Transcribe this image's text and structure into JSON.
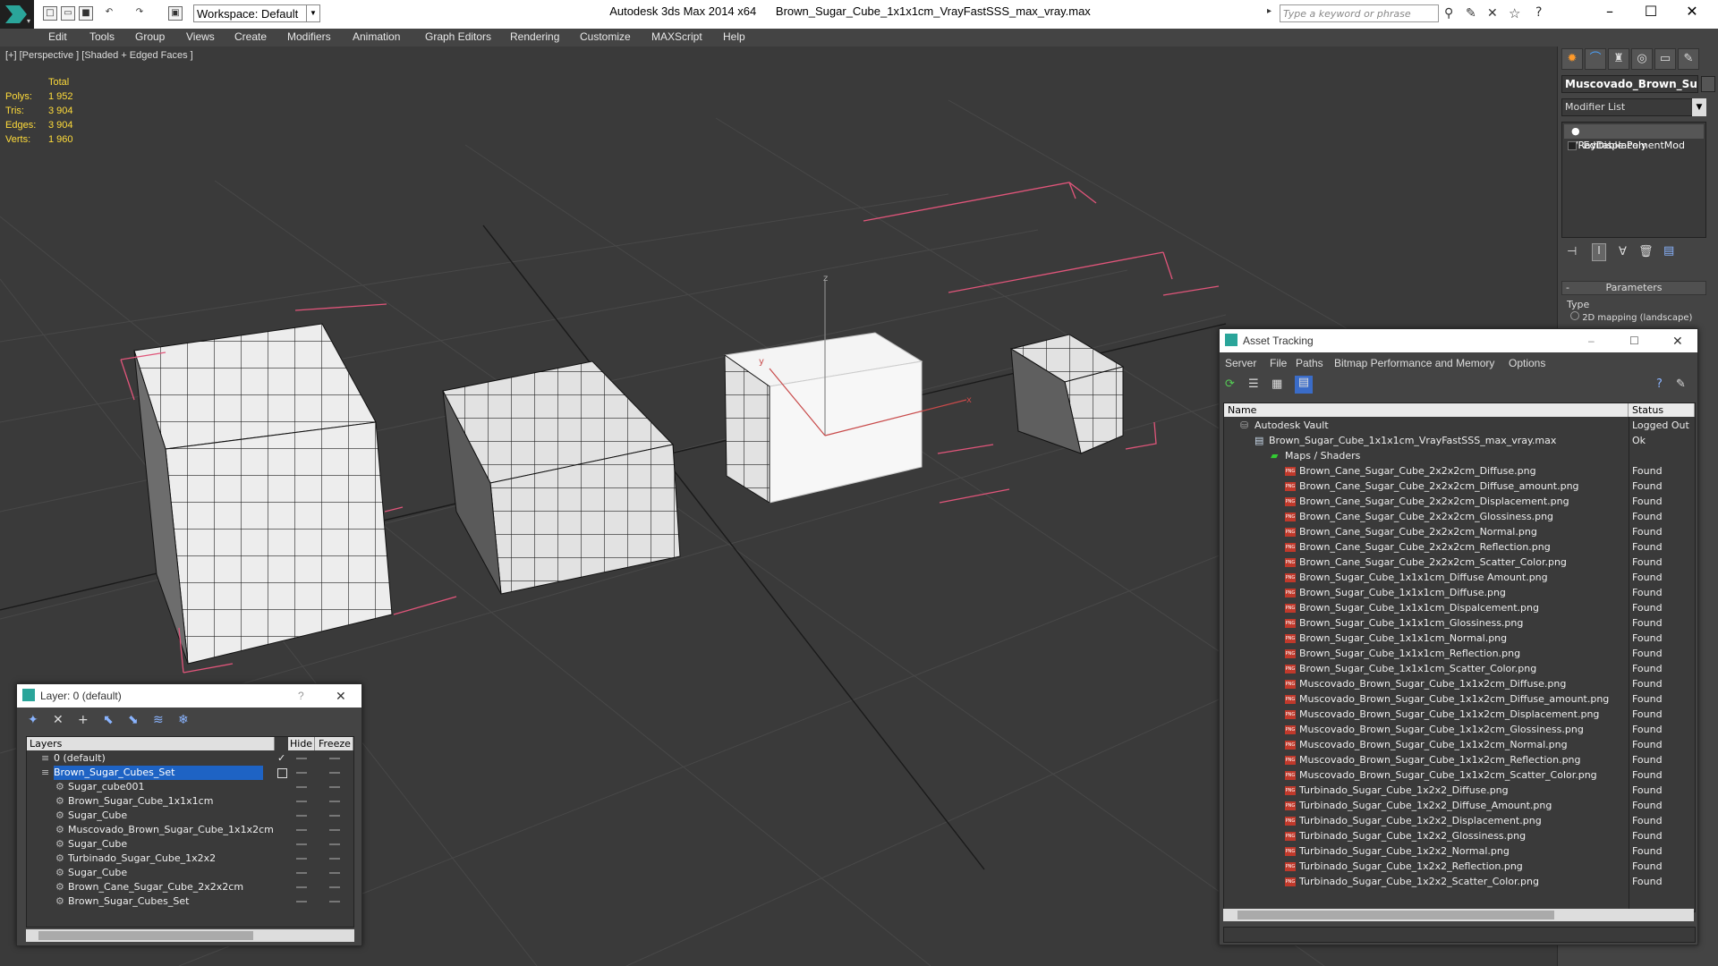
{
  "titlebar": {
    "workspace": "Workspace: Default",
    "app_name": "Autodesk 3ds Max  2014 x64",
    "file_name": "Brown_Sugar_Cube_1x1x1cm_VrayFastSSS_max_vray.max",
    "search_placeholder": "Type a keyword or phrase"
  },
  "menu": [
    "Edit",
    "Tools",
    "Group",
    "Views",
    "Create",
    "Modifiers",
    "Animation",
    "Graph Editors",
    "Rendering",
    "Customize",
    "MAXScript",
    "Help"
  ],
  "viewport": {
    "label": "[+] [Perspective ] [Shaded + Edged Faces ]",
    "stats": {
      "header": "Total",
      "rows": [
        {
          "k": "Polys:",
          "v": "1 952"
        },
        {
          "k": "Tris:",
          "v": "3 904"
        },
        {
          "k": "Edges:",
          "v": "3 904"
        },
        {
          "k": "Verts:",
          "v": "1 960"
        }
      ]
    },
    "axis_labels": {
      "x": "x",
      "y": "y",
      "z": "z"
    }
  },
  "command_panel": {
    "object_name": "Muscovado_Brown_Suga",
    "modifier_list": "Modifier List",
    "stack": [
      "VRayDisplacementMod",
      "Editable Poly"
    ],
    "params_header": "Parameters",
    "type_label": "Type",
    "type_option": "2D mapping (landscape)"
  },
  "layer_window": {
    "title": "Layer: 0 (default)",
    "help": "?",
    "columns": [
      "Layers",
      "Hide",
      "Freeze"
    ],
    "rows": [
      {
        "name": "0 (default)",
        "level": 0,
        "selected": false,
        "check": true
      },
      {
        "name": "Brown_Sugar_Cubes_Set",
        "level": 0,
        "selected": true,
        "check": false
      },
      {
        "name": "Sugar_cube001",
        "level": 1,
        "selected": false,
        "check": false
      },
      {
        "name": "Brown_Sugar_Cube_1x1x1cm",
        "level": 1,
        "selected": false,
        "check": false
      },
      {
        "name": "Sugar_Cube",
        "level": 1,
        "selected": false,
        "check": false
      },
      {
        "name": "Muscovado_Brown_Sugar_Cube_1x1x2cm",
        "level": 1,
        "selected": false,
        "check": false
      },
      {
        "name": "Sugar_Cube",
        "level": 1,
        "selected": false,
        "check": false
      },
      {
        "name": "Turbinado_Sugar_Cube_1x2x2",
        "level": 1,
        "selected": false,
        "check": false
      },
      {
        "name": "Sugar_Cube",
        "level": 1,
        "selected": false,
        "check": false
      },
      {
        "name": "Brown_Cane_Sugar_Cube_2x2x2cm",
        "level": 1,
        "selected": false,
        "check": false
      },
      {
        "name": "Brown_Sugar_Cubes_Set",
        "level": 1,
        "selected": false,
        "check": false
      }
    ]
  },
  "asset_window": {
    "title": "Asset Tracking",
    "menu": [
      "Server",
      "File",
      "Paths",
      "Bitmap Performance and Memory",
      "Options"
    ],
    "columns": [
      "Name",
      "Status"
    ],
    "rows": [
      {
        "name": "Autodesk Vault",
        "status": "Logged Out",
        "level": 0,
        "icon": "vault"
      },
      {
        "name": "Brown_Sugar_Cube_1x1x1cm_VrayFastSSS_max_vray.max",
        "status": "Ok",
        "level": 1,
        "icon": "file"
      },
      {
        "name": "Maps / Shaders",
        "status": "",
        "level": 2,
        "icon": "maps"
      },
      {
        "name": "Brown_Cane_Sugar_Cube_2x2x2cm_Diffuse.png",
        "status": "Found",
        "level": 3,
        "icon": "png"
      },
      {
        "name": "Brown_Cane_Sugar_Cube_2x2x2cm_Diffuse_amount.png",
        "status": "Found",
        "level": 3,
        "icon": "png"
      },
      {
        "name": "Brown_Cane_Sugar_Cube_2x2x2cm_Displacement.png",
        "status": "Found",
        "level": 3,
        "icon": "png"
      },
      {
        "name": "Brown_Cane_Sugar_Cube_2x2x2cm_Glossiness.png",
        "status": "Found",
        "level": 3,
        "icon": "png"
      },
      {
        "name": "Brown_Cane_Sugar_Cube_2x2x2cm_Normal.png",
        "status": "Found",
        "level": 3,
        "icon": "png"
      },
      {
        "name": "Brown_Cane_Sugar_Cube_2x2x2cm_Reflection.png",
        "status": "Found",
        "level": 3,
        "icon": "png"
      },
      {
        "name": "Brown_Cane_Sugar_Cube_2x2x2cm_Scatter_Color.png",
        "status": "Found",
        "level": 3,
        "icon": "png"
      },
      {
        "name": "Brown_Sugar_Cube_1x1x1cm_Diffuse Amount.png",
        "status": "Found",
        "level": 3,
        "icon": "png"
      },
      {
        "name": "Brown_Sugar_Cube_1x1x1cm_Diffuse.png",
        "status": "Found",
        "level": 3,
        "icon": "png"
      },
      {
        "name": "Brown_Sugar_Cube_1x1x1cm_Dispalcement.png",
        "status": "Found",
        "level": 3,
        "icon": "png"
      },
      {
        "name": "Brown_Sugar_Cube_1x1x1cm_Glossiness.png",
        "status": "Found",
        "level": 3,
        "icon": "png"
      },
      {
        "name": "Brown_Sugar_Cube_1x1x1cm_Normal.png",
        "status": "Found",
        "level": 3,
        "icon": "png"
      },
      {
        "name": "Brown_Sugar_Cube_1x1x1cm_Reflection.png",
        "status": "Found",
        "level": 3,
        "icon": "png"
      },
      {
        "name": "Brown_Sugar_Cube_1x1x1cm_Scatter_Color.png",
        "status": "Found",
        "level": 3,
        "icon": "png"
      },
      {
        "name": "Muscovado_Brown_Sugar_Cube_1x1x2cm_Diffuse.png",
        "status": "Found",
        "level": 3,
        "icon": "png"
      },
      {
        "name": "Muscovado_Brown_Sugar_Cube_1x1x2cm_Diffuse_amount.png",
        "status": "Found",
        "level": 3,
        "icon": "png"
      },
      {
        "name": "Muscovado_Brown_Sugar_Cube_1x1x2cm_Displacement.png",
        "status": "Found",
        "level": 3,
        "icon": "png"
      },
      {
        "name": "Muscovado_Brown_Sugar_Cube_1x1x2cm_Glossiness.png",
        "status": "Found",
        "level": 3,
        "icon": "png"
      },
      {
        "name": "Muscovado_Brown_Sugar_Cube_1x1x2cm_Normal.png",
        "status": "Found",
        "level": 3,
        "icon": "png"
      },
      {
        "name": "Muscovado_Brown_Sugar_Cube_1x1x2cm_Reflection.png",
        "status": "Found",
        "level": 3,
        "icon": "png"
      },
      {
        "name": "Muscovado_Brown_Sugar_Cube_1x1x2cm_Scatter_Color.png",
        "status": "Found",
        "level": 3,
        "icon": "png"
      },
      {
        "name": "Turbinado_Sugar_Cube_1x2x2_Diffuse.png",
        "status": "Found",
        "level": 3,
        "icon": "png"
      },
      {
        "name": "Turbinado_Sugar_Cube_1x2x2_Diffuse_Amount.png",
        "status": "Found",
        "level": 3,
        "icon": "png"
      },
      {
        "name": "Turbinado_Sugar_Cube_1x2x2_Displacement.png",
        "status": "Found",
        "level": 3,
        "icon": "png"
      },
      {
        "name": "Turbinado_Sugar_Cube_1x2x2_Glossiness.png",
        "status": "Found",
        "level": 3,
        "icon": "png"
      },
      {
        "name": "Turbinado_Sugar_Cube_1x2x2_Normal.png",
        "status": "Found",
        "level": 3,
        "icon": "png"
      },
      {
        "name": "Turbinado_Sugar_Cube_1x2x2_Reflection.png",
        "status": "Found",
        "level": 3,
        "icon": "png"
      },
      {
        "name": "Turbinado_Sugar_Cube_1x2x2_Scatter_Color.png",
        "status": "Found",
        "level": 3,
        "icon": "png"
      }
    ]
  },
  "colors": {
    "selection": "#1e63c4",
    "stats_text": "#ffdc3a",
    "bounding_box": "#e0557a",
    "accent_orange": "#ff9a2a"
  }
}
